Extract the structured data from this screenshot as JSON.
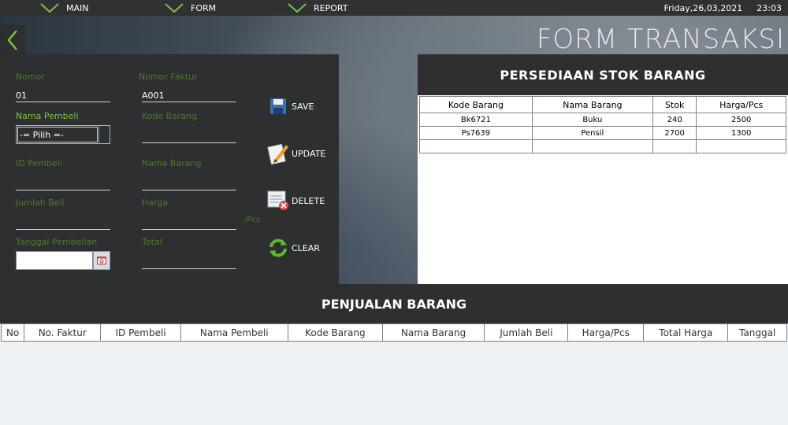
{
  "nav": {
    "main": "MAIN",
    "form": "FORM",
    "report": "REPORT",
    "date": "Friday,26,03,2021",
    "time": "23:03"
  },
  "title": "FORM TRANSAKSI",
  "form": {
    "nomor_label": "Nomor",
    "nomor_value": "01",
    "nomor_faktur_label": "Nomor Faktur",
    "nomor_faktur_value": "A001",
    "nama_pembeli_label": "Nama Pembeli",
    "nama_pembeli_selected": "-= Pilih =-",
    "kode_barang_label": "Kode Barang",
    "id_pembeli_label": "ID Pembeli",
    "nama_barang_label": "Nama Barang",
    "jumlah_beli_label": "Jumlah Beli",
    "harga_label": "Harga",
    "harga_unit": "/Pcs",
    "tanggal_label": "Tanggal Pembelian",
    "total_label": "Total"
  },
  "actions": {
    "save": "SAVE",
    "update": "UPDATE",
    "delete": "DELETE",
    "clear": "CLEAR"
  },
  "stock": {
    "title": "PERSEDIAAN STOK BARANG",
    "columns": [
      "Kode Barang",
      "Nama Barang",
      "Stok",
      "Harga/Pcs"
    ],
    "rows": [
      [
        "Bk6721",
        "Buku",
        "240",
        "2500"
      ],
      [
        "Ps7639",
        "Pensil",
        "2700",
        "1300"
      ],
      [
        "",
        "",
        "",
        ""
      ]
    ]
  },
  "sales": {
    "title": "PENJUALAN BARANG",
    "columns": [
      "No",
      "No. Faktur",
      "ID Pembeli",
      "Nama Pembeli",
      "Kode Barang",
      "Nama Barang",
      "Jumlah Beli",
      "Harga/Pcs",
      "Total Harga",
      "Tanggal"
    ]
  },
  "colors": {
    "panel": "#2d2f31",
    "label_green": "#4e7a26",
    "label_active": "#7cc242"
  }
}
